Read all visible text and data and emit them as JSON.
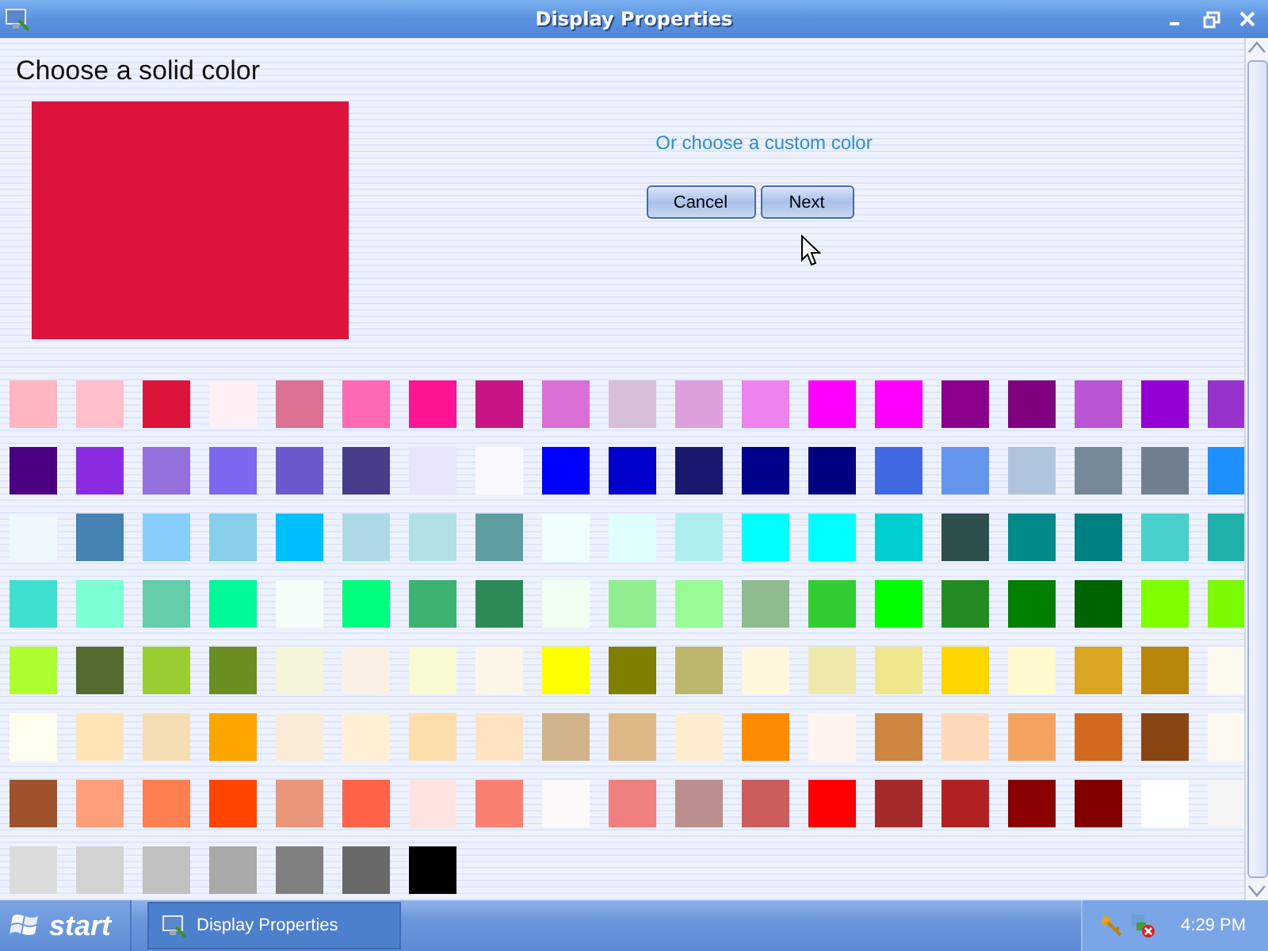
{
  "window": {
    "title": "Display Properties"
  },
  "heading": "Choose a solid color",
  "preview": {
    "color": "#dc143c"
  },
  "custom_link": "Or choose a custom color",
  "buttons": [
    "Cancel",
    "Next"
  ],
  "swatches": [
    [
      {
        "color": "#ffb6c1"
      },
      {
        "color": "#ffc0cb"
      },
      {
        "color": "#dc143c"
      },
      {
        "color": "#fff0f5"
      },
      {
        "color": "#db7093"
      },
      {
        "color": "#ff69b4"
      },
      {
        "color": "#ff1493"
      },
      {
        "color": "#c71585"
      },
      {
        "color": "#da70d6"
      },
      {
        "color": "#d8bfd8"
      },
      {
        "color": "#dda0dd"
      },
      {
        "color": "#ee82ee"
      },
      {
        "color": "#ff00ff"
      },
      {
        "color": "#ff00fe"
      },
      {
        "color": "#8b008b"
      },
      {
        "color": "#800080"
      },
      {
        "color": "#ba55d3"
      },
      {
        "color": "#9400d3"
      },
      {
        "color": "#9932cc"
      }
    ],
    [
      {
        "color": "#4b0082"
      },
      {
        "color": "#8a2be2"
      },
      {
        "color": "#9370db"
      },
      {
        "color": "#7b68ee"
      },
      {
        "color": "#6a5acd"
      },
      {
        "color": "#483d8b"
      },
      {
        "color": "#e6e6fa"
      },
      {
        "color": "#f8f8ff"
      },
      {
        "color": "#0000ff"
      },
      {
        "color": "#0000cd"
      },
      {
        "color": "#191970"
      },
      {
        "color": "#00008b"
      },
      {
        "color": "#000080"
      },
      {
        "color": "#4169e1"
      },
      {
        "color": "#6495ed"
      },
      {
        "color": "#b0c4de"
      },
      {
        "color": "#778899"
      },
      {
        "color": "#708090"
      },
      {
        "color": "#1e90ff"
      }
    ],
    [
      {
        "color": "#f0f8ff"
      },
      {
        "color": "#4682b4"
      },
      {
        "color": "#87cefa"
      },
      {
        "color": "#87ceeb"
      },
      {
        "color": "#00bfff"
      },
      {
        "color": "#add8e6"
      },
      {
        "color": "#b0e0e6"
      },
      {
        "color": "#5f9ea0"
      },
      {
        "color": "#f0ffff"
      },
      {
        "color": "#e0ffff"
      },
      {
        "color": "#afeeee"
      },
      {
        "color": "#00ffff"
      },
      {
        "color": "#00fffe"
      },
      {
        "color": "#00ced1"
      },
      {
        "color": "#2f4f4f"
      },
      {
        "color": "#008b8b"
      },
      {
        "color": "#008080"
      },
      {
        "color": "#48d1cc"
      },
      {
        "color": "#20b2aa"
      }
    ],
    [
      {
        "color": "#40e0d0"
      },
      {
        "color": "#7fffd4"
      },
      {
        "color": "#66cdaa"
      },
      {
        "color": "#00fa9a"
      },
      {
        "color": "#f5fffa"
      },
      {
        "color": "#00ff7f"
      },
      {
        "color": "#3cb371"
      },
      {
        "color": "#2e8b57"
      },
      {
        "color": "#f0fff0"
      },
      {
        "color": "#90ee90"
      },
      {
        "color": "#98fb98"
      },
      {
        "color": "#8fbc8f"
      },
      {
        "color": "#32cd32"
      },
      {
        "color": "#00ff00"
      },
      {
        "color": "#228b22"
      },
      {
        "color": "#008000"
      },
      {
        "color": "#006400"
      },
      {
        "color": "#7fff00"
      },
      {
        "color": "#7cfc00"
      }
    ],
    [
      {
        "color": "#adff2f"
      },
      {
        "color": "#556b2f"
      },
      {
        "color": "#9acd32"
      },
      {
        "color": "#6b8e23"
      },
      {
        "color": "#f5f5dc"
      },
      {
        "color": "#faf0e6"
      },
      {
        "color": "#fafad2"
      },
      {
        "color": "#fdf5e6"
      },
      {
        "color": "#ffff00"
      },
      {
        "color": "#808000"
      },
      {
        "color": "#bdb76b"
      },
      {
        "color": "#fff8dc"
      },
      {
        "color": "#eee8aa"
      },
      {
        "color": "#f0e68c"
      },
      {
        "color": "#ffd700"
      },
      {
        "color": "#fffacd"
      },
      {
        "color": "#daa520"
      },
      {
        "color": "#b8860b"
      },
      {
        "color": "#fffaf0"
      }
    ],
    [
      {
        "color": "#fffff0"
      },
      {
        "color": "#ffe4b5"
      },
      {
        "color": "#f5deb3"
      },
      {
        "color": "#ffa500"
      },
      {
        "color": "#faebd7"
      },
      {
        "color": "#ffefd5"
      },
      {
        "color": "#ffdead"
      },
      {
        "color": "#ffe4c4"
      },
      {
        "color": "#d2b48c"
      },
      {
        "color": "#deb887"
      },
      {
        "color": "#ffebcd"
      },
      {
        "color": "#ff8c00"
      },
      {
        "color": "#fff5ee"
      },
      {
        "color": "#cd853f"
      },
      {
        "color": "#ffdab9"
      },
      {
        "color": "#f4a460"
      },
      {
        "color": "#d2691e"
      },
      {
        "color": "#8b4513"
      },
      {
        "color": "#fdf8f0"
      }
    ],
    [
      {
        "color": "#a0522d"
      },
      {
        "color": "#ffa07a"
      },
      {
        "color": "#ff7f50"
      },
      {
        "color": "#ff4500"
      },
      {
        "color": "#e9967a"
      },
      {
        "color": "#ff6347"
      },
      {
        "color": "#ffe4e1"
      },
      {
        "color": "#fa8072"
      },
      {
        "color": "#fffafa"
      },
      {
        "color": "#f08080"
      },
      {
        "color": "#bc8f8f"
      },
      {
        "color": "#cd5c5c"
      },
      {
        "color": "#ff0000"
      },
      {
        "color": "#a52a2a"
      },
      {
        "color": "#b22222"
      },
      {
        "color": "#8b0000"
      },
      {
        "color": "#800000"
      },
      {
        "color": "#ffffff"
      },
      {
        "color": "#f5f5f5"
      }
    ],
    [
      {
        "color": "#dcdcdc"
      },
      {
        "color": "#d3d3d3"
      },
      {
        "color": "#c0c0c0"
      },
      {
        "color": "#a9a9a9"
      },
      {
        "color": "#808080"
      },
      {
        "color": "#696969"
      },
      {
        "color": "#000000"
      }
    ]
  ],
  "taskbar": {
    "start": "start",
    "task": "Display Properties",
    "clock": "4:29 PM"
  }
}
